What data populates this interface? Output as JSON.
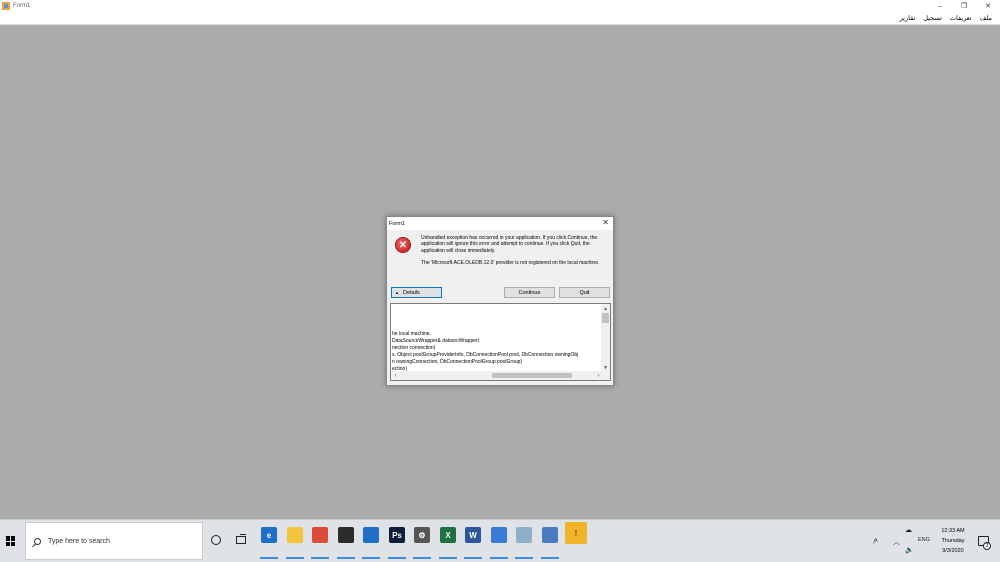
{
  "window": {
    "title": "Form1",
    "minimize_glyph": "–",
    "maximize_glyph": "❐",
    "close_glyph": "✕"
  },
  "menu": {
    "items": [
      "ملف",
      "تعريفات",
      "تسجيل",
      "تقارير"
    ]
  },
  "dialog": {
    "title": "Form1",
    "close_glyph": "✕",
    "icon": "error-icon",
    "message": "Unhandled exception has occurred in your application. If you click Continue, the application will ignore this error and attempt to continue. If you click Quit, the application will close immediately.",
    "detail_message": "The 'Microsoft.ACE.OLEDB.12.0' provider is not registered on the local machine.",
    "details_label": "Details",
    "continue_label": "Continue",
    "quit_label": "Quit",
    "details_lines": [
      "he local machine.",
      "DataSourceWrapper& datasrcWrapper)",
      "nection connection)",
      "s, Object poolGroupProviderInfo, DbConnectionPool pool, DbConnection owningObj",
      "n owningConnection, DbConnectionPoolGroup poolGroup)",
      "ection)"
    ]
  },
  "taskbar": {
    "search_placeholder": "Type here to search",
    "apps": [
      {
        "name": "edge-icon",
        "label": "e",
        "color": "#1e6fc8"
      },
      {
        "name": "file-explorer-icon",
        "label": "",
        "color": "#f2c53d"
      },
      {
        "name": "chrome-icon",
        "label": "",
        "color": "#dd4b39"
      },
      {
        "name": "store-icon",
        "label": "",
        "color": "#2b2b2b"
      },
      {
        "name": "mail-icon",
        "label": "",
        "color": "#1f6fc5"
      },
      {
        "name": "photoshop-icon",
        "label": "Ps",
        "color": "#0b1f3a"
      },
      {
        "name": "settings-icon",
        "label": "⚙",
        "color": "#555555"
      },
      {
        "name": "excel-icon",
        "label": "X",
        "color": "#1e7145"
      },
      {
        "name": "word-icon",
        "label": "W",
        "color": "#2b579a"
      },
      {
        "name": "photos-icon",
        "label": "",
        "color": "#3a7bd5"
      },
      {
        "name": "paint-icon",
        "label": "",
        "color": "#8fb0c9"
      },
      {
        "name": "document-icon",
        "label": "",
        "color": "#4a7bbf"
      },
      {
        "name": "warning-app-icon",
        "label": "!",
        "color": "#f0b429"
      }
    ],
    "lang": "ENG",
    "time": "12:33 AM",
    "day": "Thursday",
    "date": "9/3/2020",
    "notification_count": "3"
  }
}
